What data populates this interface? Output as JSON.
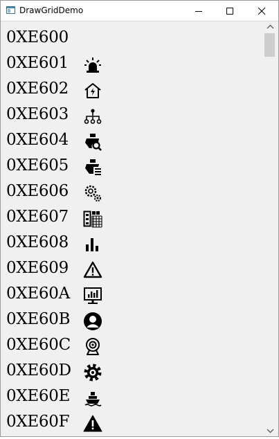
{
  "window": {
    "title": "DrawGridDemo"
  },
  "rows": [
    {
      "code": "0XE600",
      "icon": "empty"
    },
    {
      "code": "0XE601",
      "icon": "alarm-light-icon"
    },
    {
      "code": "0XE602",
      "icon": "house-power-icon"
    },
    {
      "code": "0XE603",
      "icon": "hierarchy-icon"
    },
    {
      "code": "0XE604",
      "icon": "ship-search-icon"
    },
    {
      "code": "0XE605",
      "icon": "ship-list-icon"
    },
    {
      "code": "0XE606",
      "icon": "gears-icon"
    },
    {
      "code": "0XE607",
      "icon": "building-grid-icon"
    },
    {
      "code": "0XE608",
      "icon": "bar-chart-icon"
    },
    {
      "code": "0XE609",
      "icon": "warning-outline-icon"
    },
    {
      "code": "0XE60A",
      "icon": "monitor-chart-icon"
    },
    {
      "code": "0XE60B",
      "icon": "user-circle-icon"
    },
    {
      "code": "0XE60C",
      "icon": "webcam-icon"
    },
    {
      "code": "0XE60D",
      "icon": "cog-icon"
    },
    {
      "code": "0XE60E",
      "icon": "ship-icon"
    },
    {
      "code": "0XE60F",
      "icon": "warning-solid-icon"
    }
  ]
}
